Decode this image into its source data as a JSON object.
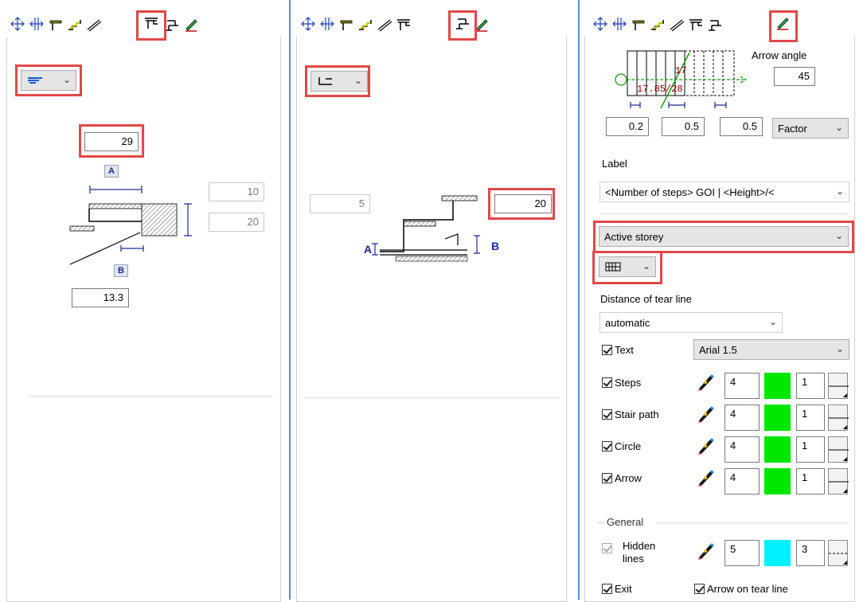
{
  "panel1": {
    "field_top": "29",
    "badge_a": "A",
    "badge_b": "B",
    "field_right_top": "10",
    "field_right_bottom": "20",
    "field_bottom": "13.3"
  },
  "panel2": {
    "field_left": "5",
    "field_right": "20",
    "label_a": "A",
    "label_b": "B"
  },
  "panel3": {
    "arrow_angle_label": "Arrow angle",
    "arrow_angle_value": "45",
    "diagram_text_1": "17",
    "diagram_text_2": "17.85/28",
    "field_1": "0.2",
    "field_2": "0.5",
    "field_3": "0.5",
    "factor_value": "Factor",
    "label_heading": "Label",
    "label_value": "<Number of steps> GOI | <Height>/<",
    "storey_value": "Active storey",
    "tear_heading": "Distance of tear line",
    "tear_value": "automatic",
    "text_label": "Text",
    "font_value": "Arial 1.5",
    "rows": [
      {
        "label": "Steps",
        "pen": "4",
        "line": "1",
        "color": "#00e600"
      },
      {
        "label": "Stair path",
        "pen": "4",
        "line": "1",
        "color": "#00e600"
      },
      {
        "label": "Circle",
        "pen": "4",
        "line": "1",
        "color": "#00e600"
      },
      {
        "label": "Arrow",
        "pen": "4",
        "line": "1",
        "color": "#00e600"
      }
    ],
    "general_heading": "General",
    "hidden_label": "Hidden\nlines",
    "hidden_pen": "5",
    "hidden_line": "3",
    "hidden_color": "#00f0ff",
    "exit_label": "Exit",
    "arrow_tear_label": "Arrow on tear line"
  },
  "colors": {
    "highlight": "#e04848",
    "separator": "#4a8fd6"
  }
}
